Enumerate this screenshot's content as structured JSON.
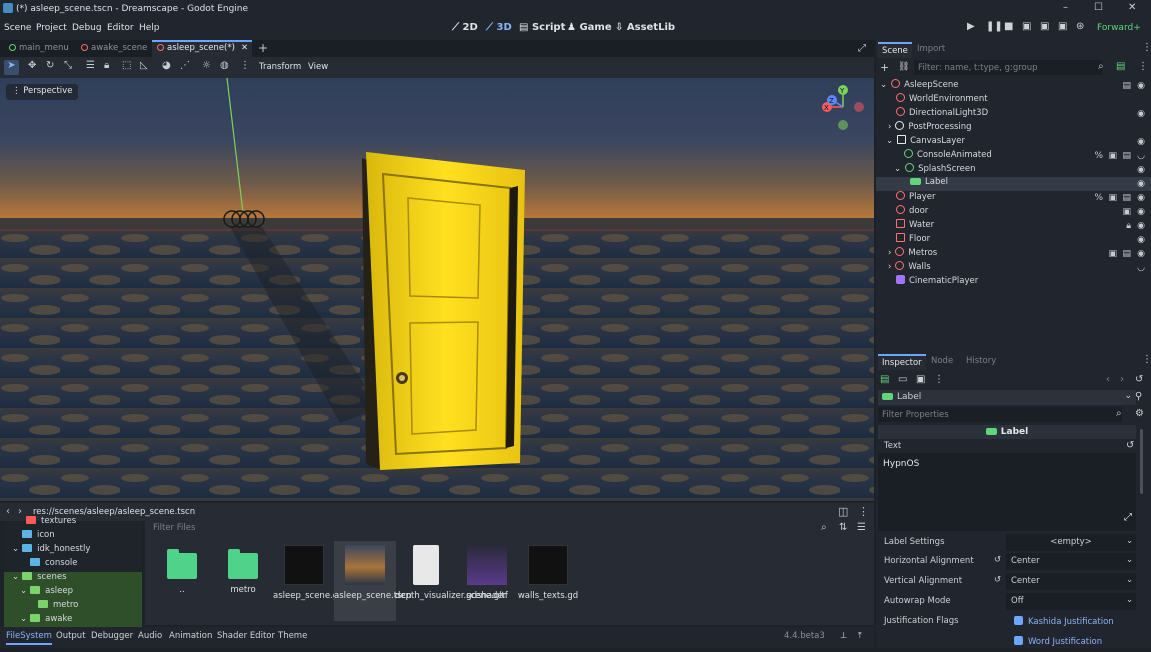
{
  "window": {
    "title": "(*) asleep_scene.tscn - Dreamscape - Godot Engine",
    "min": "–",
    "max": "☐",
    "close": "✕"
  },
  "menu": [
    "Scene",
    "Project",
    "Debug",
    "Editor",
    "Help"
  ],
  "modes": [
    "2D",
    "3D",
    "Script",
    "Game",
    "AssetLib"
  ],
  "renderer": "Forward+",
  "scene_tabs": [
    {
      "label": "main_menu",
      "color": "green"
    },
    {
      "label": "awake_scene",
      "color": "red"
    },
    {
      "label": "asleep_scene(*)",
      "color": "red",
      "active": true
    }
  ],
  "toolbar": {
    "transform": "Transform",
    "view": "View"
  },
  "viewport": {
    "label": "Perspective",
    "gizmo": {
      "y": "Y",
      "x": "X",
      "z": "Z"
    }
  },
  "filesystem": {
    "path": "res://scenes/asleep/asleep_scene.tscn",
    "filter_placeholder": "Filter Files",
    "tree": [
      {
        "label": "textures",
        "indent": 1,
        "icon": "red"
      },
      {
        "label": "icon",
        "indent": 0,
        "icon": "blue"
      },
      {
        "label": "idk_honestly",
        "indent": 0,
        "icon": "blue"
      },
      {
        "label": "console",
        "indent": 1,
        "icon": "blue"
      },
      {
        "label": "scenes",
        "indent": 0,
        "icon": "green",
        "sel": true
      },
      {
        "label": "asleep",
        "indent": 1,
        "icon": "green",
        "sel": true
      },
      {
        "label": "metro",
        "indent": 2,
        "icon": "green",
        "sel": true
      },
      {
        "label": "awake",
        "indent": 1,
        "icon": "green",
        "sel": true
      }
    ],
    "files": [
      {
        "label": "..",
        "kind": "folder"
      },
      {
        "label": "metro",
        "kind": "folder"
      },
      {
        "label": "asleep_scene.gd",
        "kind": "script"
      },
      {
        "label": "asleep_scene.tscn",
        "kind": "scene"
      },
      {
        "label": "depth_visualizer.gdshader",
        "kind": "doc"
      },
      {
        "label": "scene.gltf",
        "kind": "model"
      },
      {
        "label": "walls_texts.gd",
        "kind": "script"
      }
    ]
  },
  "bottom_tabs": [
    "FileSystem",
    "Output",
    "Debugger",
    "Audio",
    "Animation",
    "Shader Editor",
    "Theme"
  ],
  "version": "4.4.beta3",
  "scene_dock": {
    "tabs": [
      "Scene",
      "Import"
    ],
    "filter_placeholder": "Filter: name, t:type, g:group",
    "nodes": [
      {
        "label": "AsleepScene",
        "indent": 0,
        "icon": "red",
        "arrow": "⌄"
      },
      {
        "label": "WorldEnvironment",
        "indent": 1,
        "icon": "red"
      },
      {
        "label": "DirectionalLight3D",
        "indent": 1,
        "icon": "red"
      },
      {
        "label": "PostProcessing",
        "indent": 1,
        "icon": "white",
        "arrow": "›"
      },
      {
        "label": "CanvasLayer",
        "indent": 1,
        "icon": "white",
        "arrow": "⌄"
      },
      {
        "label": "ConsoleAnimated",
        "indent": 2,
        "icon": "green"
      },
      {
        "label": "SplashScreen",
        "indent": 2,
        "icon": "green",
        "arrow": "⌄"
      },
      {
        "label": "Label",
        "indent": 3,
        "icon": "label",
        "sel": true
      },
      {
        "label": "Player",
        "indent": 1,
        "icon": "red"
      },
      {
        "label": "door",
        "indent": 1,
        "icon": "red"
      },
      {
        "label": "Water",
        "indent": 1,
        "icon": "red"
      },
      {
        "label": "Floor",
        "indent": 1,
        "icon": "red"
      },
      {
        "label": "Metros",
        "indent": 1,
        "icon": "red",
        "arrow": "›"
      },
      {
        "label": "Walls",
        "indent": 1,
        "icon": "red",
        "arrow": "›"
      },
      {
        "label": "CinematicPlayer",
        "indent": 1,
        "icon": "purple"
      }
    ]
  },
  "inspector": {
    "tabs": [
      "Inspector",
      "Node",
      "History"
    ],
    "object": "Label",
    "filter_placeholder": "Filter Properties",
    "section": "Label",
    "text_label": "Text",
    "text_value": "HypnOS",
    "props": [
      {
        "name": "Label Settings",
        "value": "<empty>"
      },
      {
        "name": "Horizontal Alignment",
        "value": "Center"
      },
      {
        "name": "Vertical Alignment",
        "value": "Center"
      },
      {
        "name": "Autowrap Mode",
        "value": "Off"
      }
    ],
    "flags_label": "Justification Flags",
    "flags": [
      "Kashida Justification",
      "Word Justification"
    ]
  }
}
